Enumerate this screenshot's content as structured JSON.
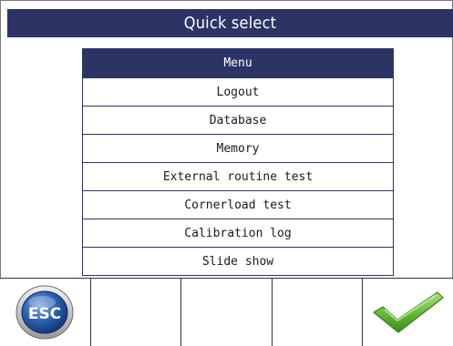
{
  "title": "Quick select",
  "menu": {
    "items": [
      "Menu",
      "Logout",
      "Database",
      "Memory",
      "External routine test",
      "Cornerload test",
      "Calibration log",
      "Slide show"
    ],
    "selected": "Menu"
  },
  "softkeys": [
    {
      "icon": "esc-icon",
      "label": "ESC"
    },
    {
      "icon": "",
      "label": ""
    },
    {
      "icon": "",
      "label": ""
    },
    {
      "icon": "",
      "label": ""
    },
    {
      "icon": "checkmark-icon",
      "label": ""
    }
  ],
  "colors": {
    "header": "#2c3466",
    "selection": "#2c3466",
    "esc_blue": "#1f4f9a",
    "check_green": "#5cb531"
  }
}
